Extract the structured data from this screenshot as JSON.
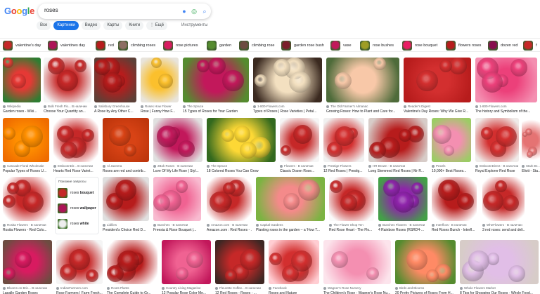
{
  "search": {
    "query": "roses"
  },
  "tabs": [
    "Все",
    "Картинки",
    "Видео",
    "Карты",
    "Книги",
    "⋮ Ещё"
  ],
  "active_tab": 1,
  "tools_label": "Инструменты",
  "chips": [
    "valentine's day",
    "valentines day",
    "red",
    "climbing roses",
    "rose pictures",
    "garden",
    "climbing rose",
    "garden rose bush",
    "vase",
    "rose bushes",
    "rose bouquet",
    "flowers roses",
    "dozen red",
    "f"
  ],
  "related": {
    "heading": "Похожие запросы",
    "items": [
      {
        "prefix": "roses ",
        "bold": "bouquet"
      },
      {
        "prefix": "roses ",
        "bold": "wallpaper"
      },
      {
        "prefix": "roses ",
        "bold": "white"
      }
    ]
  },
  "rows": [
    [
      {
        "src": "Wikipedia",
        "title": "Garden roses - Wiki..."
      },
      {
        "src": "Bulk Fresh Flo... В наличии",
        "title": "Choose Your Quantity an..."
      },
      {
        "src": "Salisbury Greenhouse",
        "title": "A Rose by Any Other C..."
      },
      {
        "src": "Roses How Flower",
        "title": "Rose | Funny How F..."
      },
      {
        "src": "The Spruce",
        "title": "15 Types of Roses for Your Garden"
      },
      {
        "src": "1-800-Flowers.com",
        "title": "Types of Roses | Rose Varieties | Petal..."
      },
      {
        "src": "The Old Farmer's Almanac",
        "title": "Growing Roses: How to Plant and Care for..."
      },
      {
        "src": "Reader's Digest",
        "title": "Valentine's Day Roses: Why We Give R..."
      },
      {
        "src": "1-800-Flowers.com",
        "title": "The history and Symbolism of the..."
      }
    ],
    [
      {
        "src": "Cascade Floral Wholesale",
        "title": "Popular Types of Roses U..."
      },
      {
        "src": "EtsbooInDir... В наличии",
        "title": "Hearts Red Rose Variet..."
      },
      {
        "src": "Al Jazeera",
        "title": "Roses are red and contrib..."
      },
      {
        "src": "2Bok Roses · В наличии",
        "title": "Love Of My Life Rose | Styl..."
      },
      {
        "src": "The Spruce",
        "title": "18 Colored Roses You Can Grow"
      },
      {
        "src": "Flowers · В наличии",
        "title": "Classic Dozen Rose..."
      },
      {
        "src": "Prestige Flowers",
        "title": "12 Red Roses | Prestig..."
      },
      {
        "src": "HR Brown · В наличии",
        "title": "Long Stemmed Red Roses | Mr R..."
      },
      {
        "src": "Pexels",
        "title": "10,000+ Best Roses..."
      },
      {
        "src": "EtsbooInDirect · В наличии",
        "title": "Royal Explorer Red Rose"
      },
      {
        "src": "Stark Br...",
        "title": "Eliott - Sta..."
      }
    ],
    [
      {
        "src": "Rosita Flowers · В наличии",
        "title": "Rosita Flowers - Red Colo..."
      },
      {
        "src": "Lidl/ies",
        "title": "President's Choice Red D..."
      },
      {
        "src": "Bunches · В наличии",
        "title": "Freesia & Rose Bouquet |..."
      },
      {
        "src": "Amazon.com · В наличии",
        "title": "Amazon.com : Red Roses - ..."
      },
      {
        "src": "Capital Gardens",
        "title": "Planting roses in the garden – a 'How T..."
      },
      {
        "src": "The Flower Shop Ten",
        "title": "Red Rose Heart - The Flo..."
      },
      {
        "src": "Bunches Flowers · В наличии",
        "title": "4 Rainbow Roses (RSRD4-..."
      },
      {
        "src": "Interflora · В наличии",
        "title": "Red Roses Bunch - Interfl..."
      },
      {
        "src": "WheFlowers · В наличии",
        "title": "3 red roses: send and deli..."
      }
    ],
    [
      {
        "src": "Blooms on Bric... В наличии",
        "title": "Lapalle Garden Roses"
      },
      {
        "src": "IndianFarmers.com",
        "title": "Rose Farmers | Farm Fresh..."
      },
      {
        "src": "Roots Plants",
        "title": "The Complete Guide to Gr..."
      },
      {
        "src": "Country Living Magazine",
        "title": "12 Popular Rose Color Me..."
      },
      {
        "src": "Fleurette Coffee... В наличии",
        "title": "12 Red Roses - Roses - ..."
      },
      {
        "src": "Facebook",
        "title": "Roses and Nature"
      },
      {
        "src": "Wagner's Rose Nursery",
        "title": "The Children's Rose - Wagner's Rose Nu..."
      },
      {
        "src": "Birds and Blooms",
        "title": "20 Pretty Pictures of Roses From H..."
      },
      {
        "src": "Whole Flowers Market",
        "title": "8 Tips for Shopping Our Roses · Whole Food..."
      }
    ]
  ]
}
